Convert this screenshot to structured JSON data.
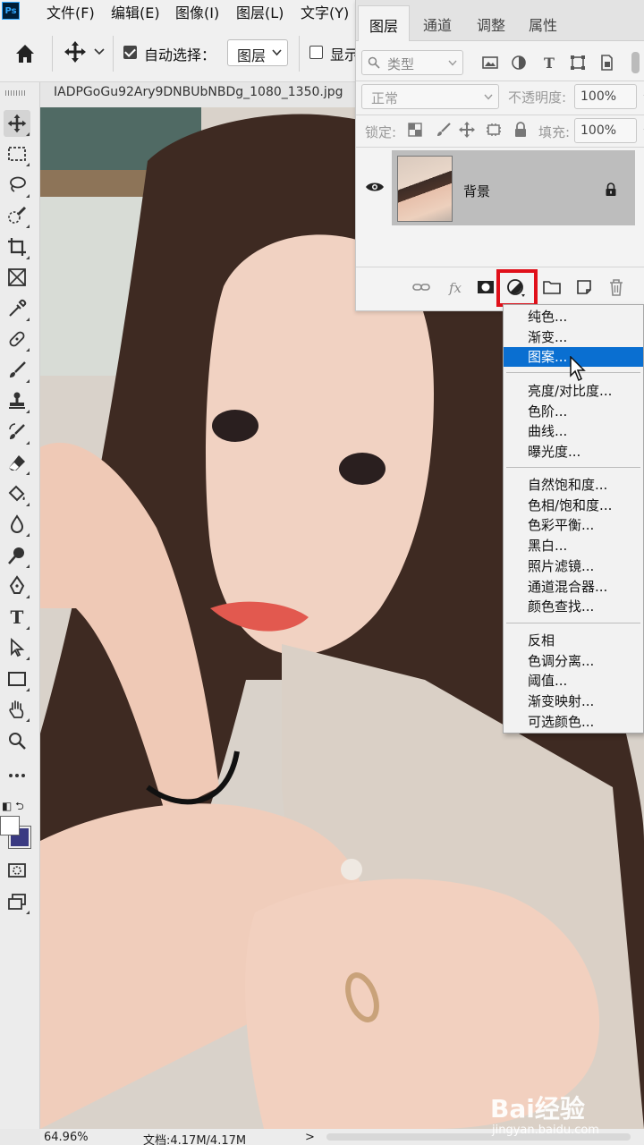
{
  "app": {
    "logo": "Ps"
  },
  "menubar": {
    "items": [
      "文件(F)",
      "编辑(E)",
      "图像(I)",
      "图层(L)",
      "文字(Y)"
    ]
  },
  "options_bar": {
    "auto_select_label": "自动选择：",
    "auto_select_checked": true,
    "target_value": "图层",
    "show_transform_label": "显示"
  },
  "document": {
    "tab_title": "IADPGoGu92Ary9DNBUbNBDg_1080_1350.jpg"
  },
  "status": {
    "zoom": "64.96%",
    "doc_info": "文档:4.17M/4.17M",
    "arrow": ">"
  },
  "colors": {
    "foreground": "#ffffff",
    "background": "#3a3a82",
    "accent": "#0a6fd1",
    "highlight": "#e0101a"
  },
  "layers_panel": {
    "tabs": [
      "图层",
      "通道",
      "调整",
      "属性"
    ],
    "active_tab": "图层",
    "filter_placeholder": "类型",
    "blend_mode": "正常",
    "opacity_label": "不透明度:",
    "opacity_value": "100%",
    "lock_label": "锁定:",
    "fill_label": "填充:",
    "fill_value": "100%",
    "layers": [
      {
        "name": "背景",
        "visible": true,
        "locked": true
      }
    ],
    "footer_icons": [
      "link-icon",
      "fx-icon",
      "mask-icon",
      "adjustment-layer-icon",
      "folder-icon",
      "new-layer-icon",
      "trash-icon"
    ]
  },
  "adjustment_menu": {
    "groups": [
      [
        "纯色...",
        "渐变...",
        "图案..."
      ],
      [
        "亮度/对比度...",
        "色阶...",
        "曲线...",
        "曝光度..."
      ],
      [
        "自然饱和度...",
        "色相/饱和度...",
        "色彩平衡...",
        "黑白...",
        "照片滤镜...",
        "通道混合器...",
        "颜色查找..."
      ],
      [
        "反相",
        "色调分离...",
        "阈值...",
        "渐变映射...",
        "可选颜色..."
      ]
    ],
    "selected": "图案..."
  },
  "watermark": {
    "logo": "Bai经验",
    "url": "jingyan.baidu.com"
  }
}
